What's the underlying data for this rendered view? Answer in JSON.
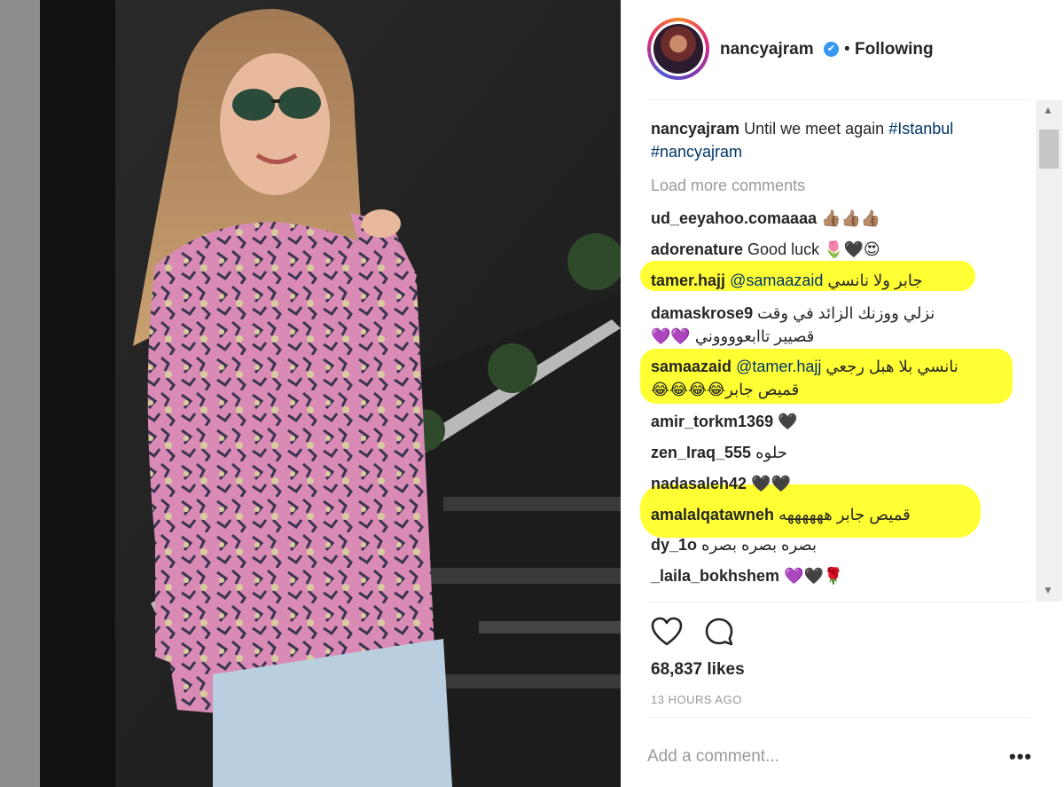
{
  "header": {
    "username": "nancyajram",
    "verified_glyph": "✔",
    "separator": "•",
    "follow_status": "Following"
  },
  "caption": {
    "username": "nancyajram",
    "text": "Until we meet again",
    "hashtags": [
      "#Istanbul",
      "#nancyajram"
    ]
  },
  "load_more": "Load more comments",
  "comments": [
    {
      "user": "ud_eeyahoo.comaaaa",
      "text": "👍🏽👍🏽👍🏽",
      "highlighted": false
    },
    {
      "user": "adorenature",
      "text": "Good luck 🌷🖤😍",
      "highlighted": false
    },
    {
      "user": "tamer.hajj",
      "mention": "@samaazaid",
      "text": "جابر ولا نانسي",
      "highlighted": true
    },
    {
      "user": "damaskrose9",
      "text": "نزلي ووزنك الزائد في وقت",
      "text2": "💜💜 قصيير تاابعووووني",
      "highlighted": false
    },
    {
      "user": "samaazaid",
      "mention": "@tamer.hajj",
      "text": "نانسي بلا هبل رجعي",
      "text2": "😂😂😂😂قميص جابر",
      "highlighted": true
    },
    {
      "user": "amir_torkm1369",
      "text": "🖤",
      "highlighted": false
    },
    {
      "user": "zen_Iraq_555",
      "text": "حلوه",
      "highlighted": false
    },
    {
      "user": "nadasaleh42",
      "text": "🖤🖤",
      "highlighted": false
    },
    {
      "user": "amalalqatawneh",
      "text": "قميص جابر ههههههه",
      "highlighted": true
    },
    {
      "user": "dy_1o",
      "text": "بصره بصره بصره",
      "highlighted": false
    },
    {
      "user": "_laila_bokhshem",
      "text": "💜🖤🌹",
      "highlighted": false
    }
  ],
  "actions": {
    "likes": "68,837 likes",
    "time_ago": "13 HOURS AGO",
    "add_comment_placeholder": "Add a comment...",
    "more_glyph": "•••",
    "heart_icon": "heart-outline",
    "comment_icon": "speech-bubble-outline"
  },
  "scrollbar": {
    "up_glyph": "▲",
    "down_glyph": "▼"
  },
  "colors": {
    "hashtag": "#003569",
    "highlight": "#ffff33",
    "verified": "#3897f0",
    "muted": "#999999"
  }
}
